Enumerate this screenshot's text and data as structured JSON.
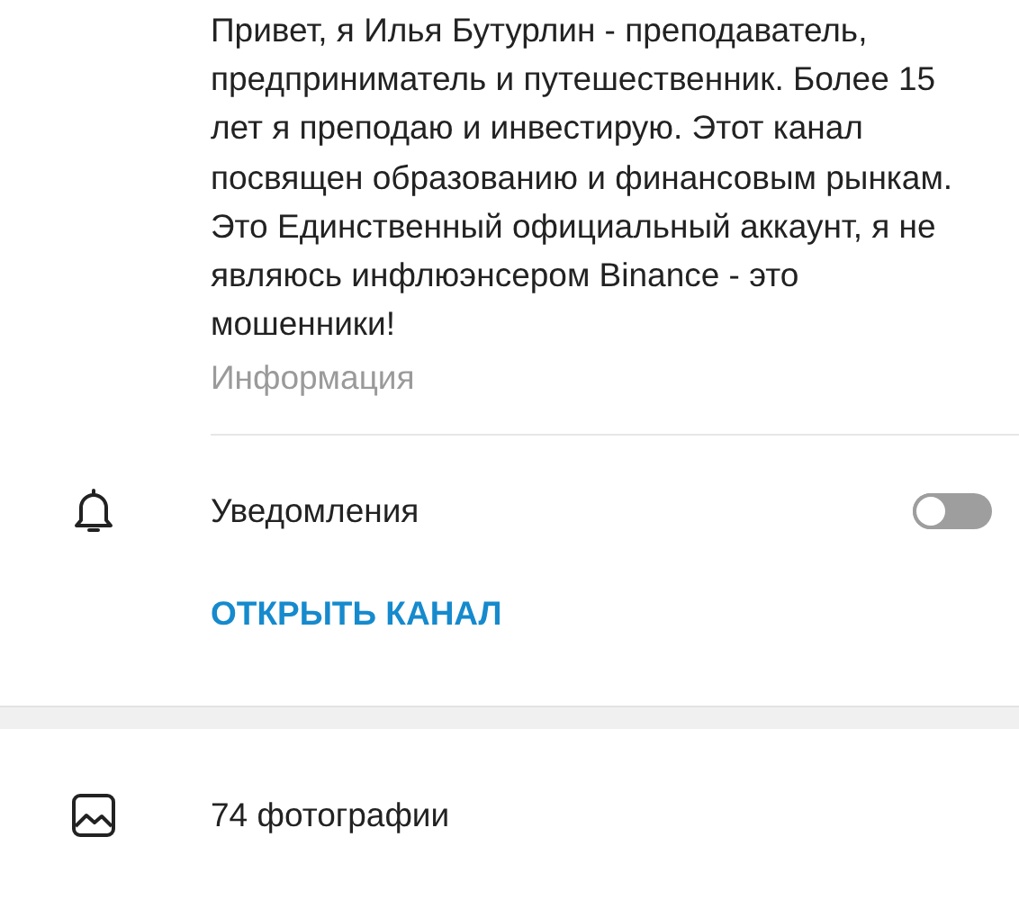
{
  "about": {
    "description": [
      "Привет, я Илья Бутурлин - преподаватель, предприниматель и путешественник. Более 15 лет я преподаю и инвестирую. Этот канал посвящен образованию и финансовым рынкам.",
      "Это Единственный официальный аккаунт, я не являюсь инфлюэнсером Binance - это мошенники!"
    ],
    "caption": "Информация"
  },
  "notifications": {
    "label": "Уведомления",
    "on": false
  },
  "open_channel": {
    "label": "ОТКРЫТЬ КАНАЛ"
  },
  "media": [
    {
      "kind": "photos",
      "label": "74 фотографии"
    }
  ]
}
